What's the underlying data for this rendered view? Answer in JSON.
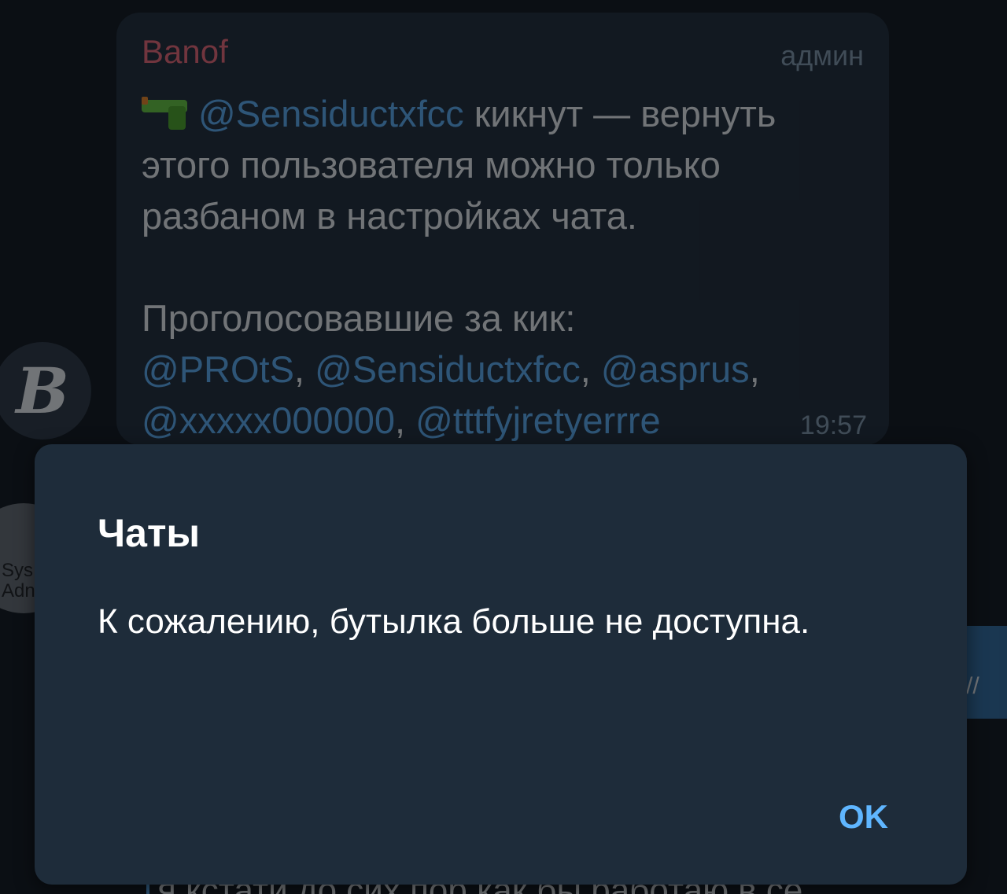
{
  "chat": {
    "message": {
      "sender": "Banof",
      "role_tag": "админ",
      "icon": "water-pistol-icon",
      "kicked_user": "@Sensiductxfcc",
      "text_kicked": " кикнут — вернуть этого пользователя можно только разбаном в настройках чата.",
      "voters_label": "Проголосовавшие за кик:",
      "voters": [
        "@PROtS",
        "@Sensiductxfcc",
        "@asprus",
        "@xxxxx000000",
        "@tttfyjretyerrre"
      ],
      "time": "19:57"
    },
    "avatar_b_letter": "B",
    "avatar_sys_line1": "Sys",
    "avatar_sys_line2": "Adn",
    "bottom_preview": "я кстати до сих пор как бы работаю в се..."
  },
  "dialog": {
    "title": "Чаты",
    "body": "К сожалению, бутылка больше не доступна.",
    "ok_label": "OK"
  },
  "colors": {
    "background": "#0b0f14",
    "bubble": "#1c2733",
    "dialog": "#1e2c3a",
    "accent": "#5fb6ff",
    "sender_name": "#ff6a78"
  }
}
